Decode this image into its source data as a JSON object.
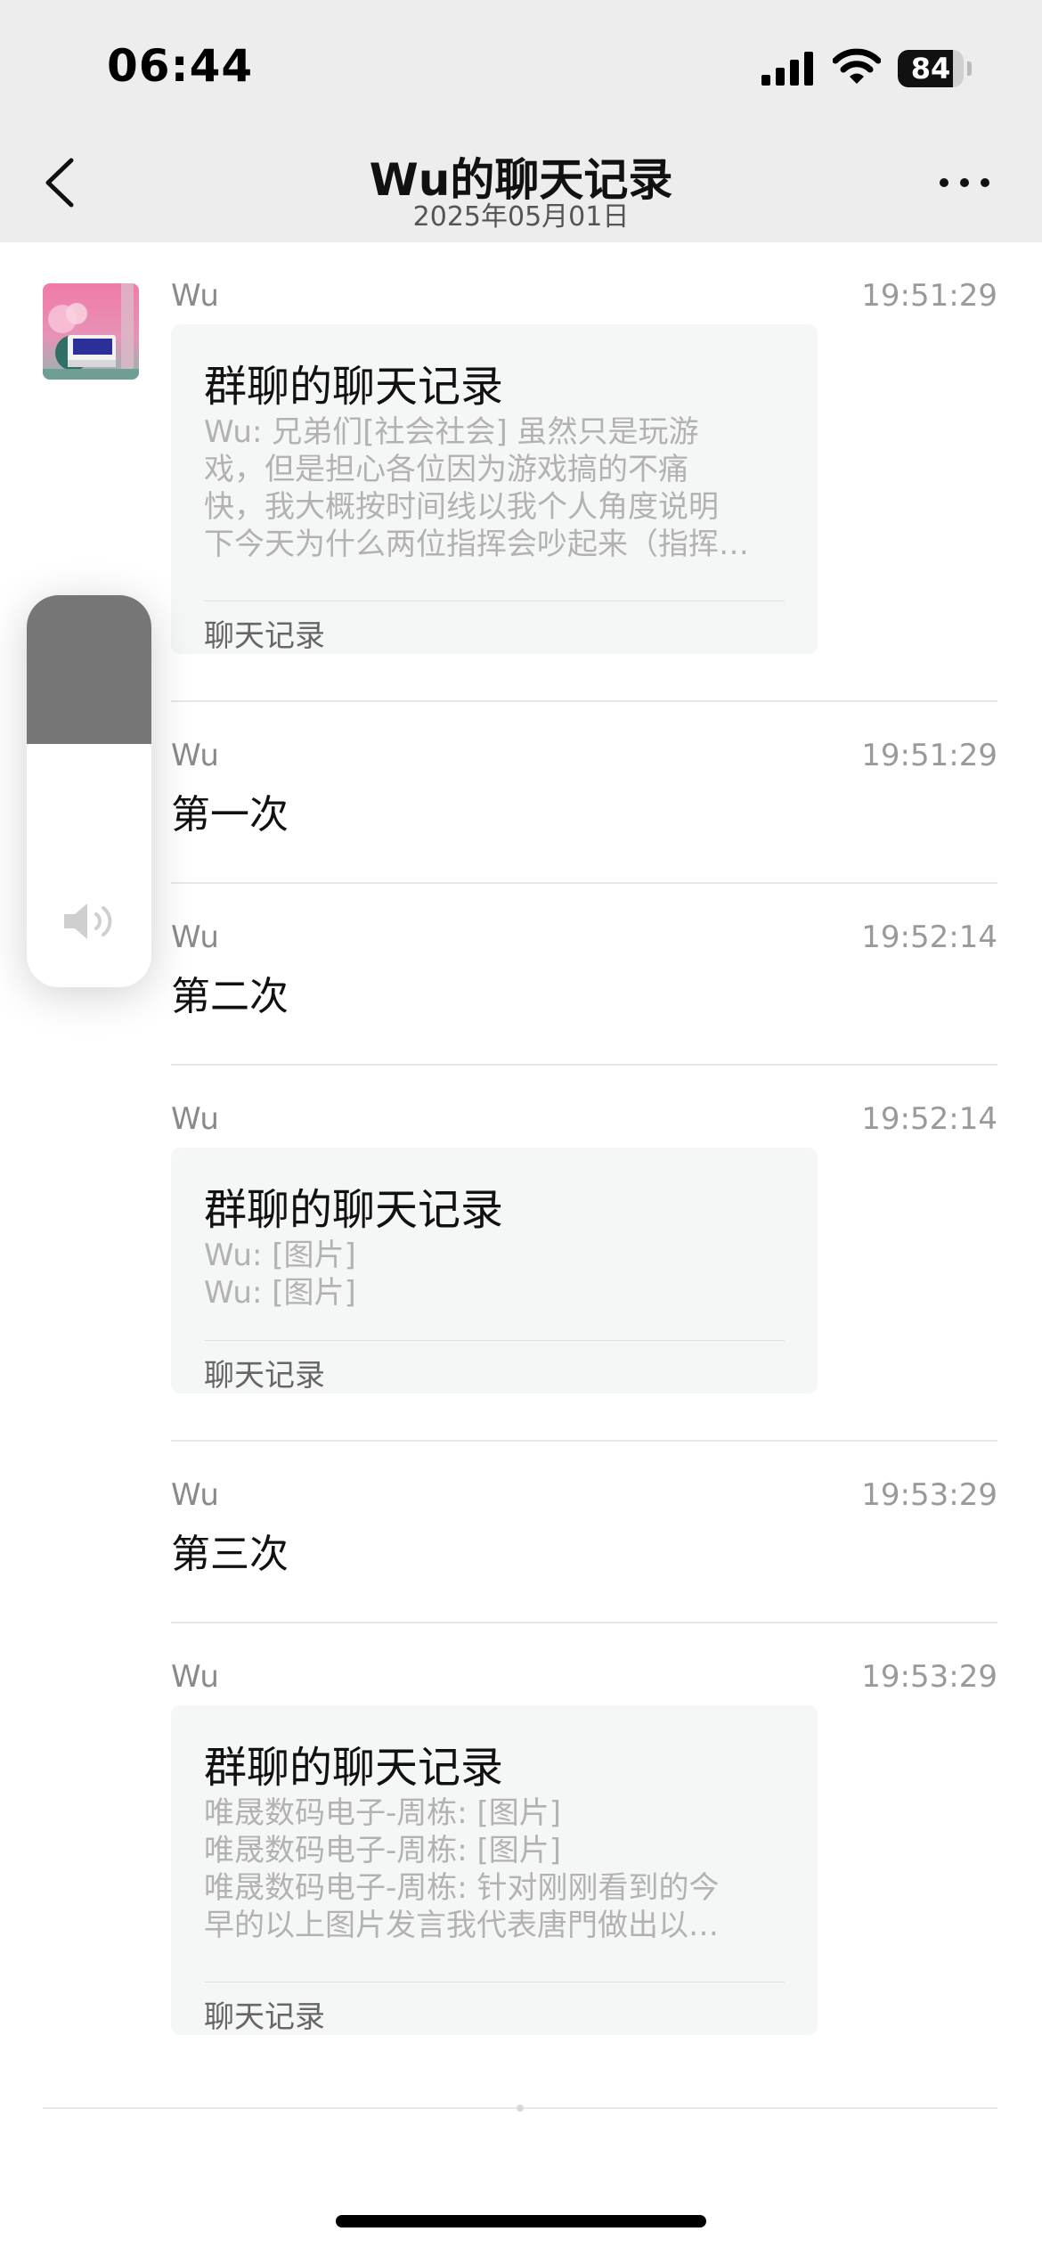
{
  "status_bar": {
    "time": "06:44",
    "battery_percent": 84
  },
  "nav": {
    "title": "Wu的聊天记录",
    "subtitle": "2025年05月01日"
  },
  "volume_hud": {
    "level": 0.38
  },
  "messages": [
    {
      "sender": "Wu",
      "time": "19:51:29",
      "type": "record",
      "card": {
        "title": "群聊的聊天记录",
        "preview": [
          "Wu: 兄弟们[社会社会] 虽然只是玩游",
          "戏，但是担心各位因为游戏搞的不痛",
          "快，我大概按时间线以我个人角度说明",
          "下今天为什么两位指挥会吵起来（指挥…"
        ],
        "footer": "聊天记录"
      }
    },
    {
      "sender": "Wu",
      "time": "19:51:29",
      "type": "text",
      "text": "第一次"
    },
    {
      "sender": "Wu",
      "time": "19:52:14",
      "type": "text",
      "text": "第二次"
    },
    {
      "sender": "Wu",
      "time": "19:52:14",
      "type": "record",
      "card": {
        "title": "群聊的聊天记录",
        "preview": [
          "Wu: [图片]",
          "Wu: [图片]"
        ],
        "footer": "聊天记录"
      }
    },
    {
      "sender": "Wu",
      "time": "19:53:29",
      "type": "text",
      "text": "第三次"
    },
    {
      "sender": "Wu",
      "time": "19:53:29",
      "type": "record",
      "card": {
        "title": "群聊的聊天记录",
        "preview": [
          "唯晟数码电子-周栋: [图片]",
          "唯晟数码电子-周栋: [图片]",
          "唯晟数码电子-周栋: 针对刚刚看到的今",
          "早的以上图片发言我代表唐門做出以…"
        ],
        "footer": "聊天记录"
      }
    }
  ]
}
